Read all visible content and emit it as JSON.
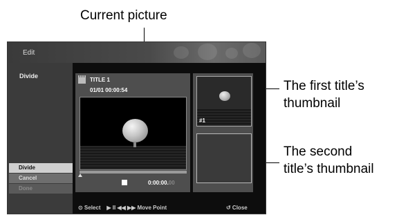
{
  "callouts": {
    "current_picture": "Current picture",
    "first_thumb_line1": "The first title’s",
    "first_thumb_line2": "thumbnail",
    "second_thumb_line1": "The second",
    "second_thumb_line2": "title’s thumbnail"
  },
  "screen": {
    "header_title": "Edit",
    "side_label": "Divide",
    "menu": [
      {
        "label": "Divide",
        "state": "selected"
      },
      {
        "label": "Cancel",
        "state": "normal"
      },
      {
        "label": "Done",
        "state": "disabled"
      }
    ],
    "preview": {
      "title": "TITLE 1",
      "date_time": "01/01  00:00:54",
      "time_main": "0:00:00.",
      "time_frames": "00",
      "stop_icon": "stop-icon"
    },
    "thumbnails": {
      "first_label": "#1"
    },
    "bottom_hints": {
      "select": "⊙ Select",
      "move_point": "▶ II ◀◀ ▶▶  Move Point",
      "close": "↺ Close"
    }
  },
  "colors": {
    "menu_selected_bg": "#cfcfcf",
    "menu_normal_bg": "#6e6e6e",
    "menu_disabled_bg": "#5a5a5a"
  }
}
